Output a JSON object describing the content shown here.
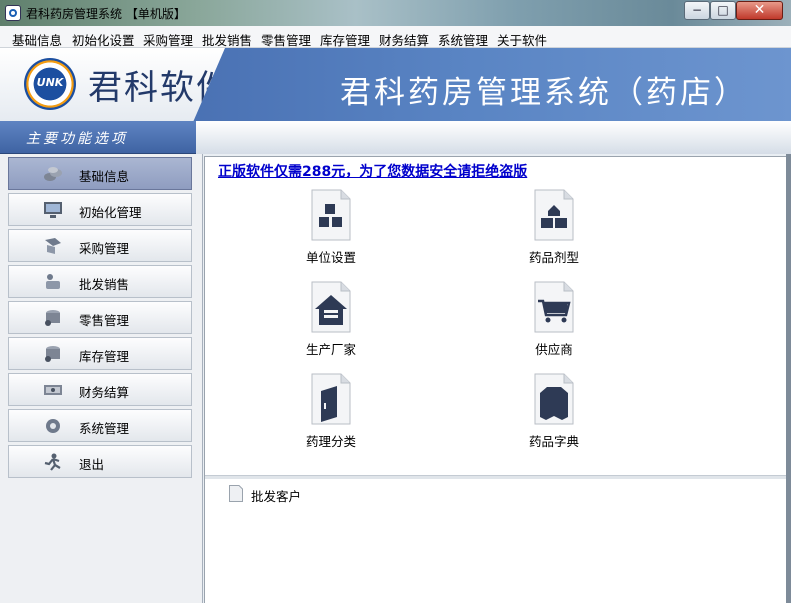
{
  "window": {
    "title": "君科药房管理系统 【单机版】",
    "buttons": {
      "minimize": "−",
      "maximize": "□",
      "close": "✕"
    }
  },
  "menu": [
    "基础信息",
    "初始化设置",
    "采购管理",
    "批发销售",
    "零售管理",
    "库存管理",
    "财务结算",
    "系统管理",
    "关于软件"
  ],
  "banner": {
    "logo_badge": "UNK",
    "logo_text": "君科软件",
    "system_title": "君科药房管理系统（药店）"
  },
  "sidebar": {
    "header": "主要功能选项",
    "items": [
      {
        "label": "基础信息",
        "icon": "stack-icon",
        "active": true
      },
      {
        "label": "初始化管理",
        "icon": "monitor-icon",
        "active": false
      },
      {
        "label": "采购管理",
        "icon": "purchase-icon",
        "active": false
      },
      {
        "label": "批发销售",
        "icon": "wholesale-icon",
        "active": false
      },
      {
        "label": "零售管理",
        "icon": "retail-icon",
        "active": false
      },
      {
        "label": "库存管理",
        "icon": "inventory-icon",
        "active": false
      },
      {
        "label": "财务结算",
        "icon": "money-icon",
        "active": false
      },
      {
        "label": "系统管理",
        "icon": "gear-icon",
        "active": false
      },
      {
        "label": "退出",
        "icon": "exit-icon",
        "active": false
      }
    ]
  },
  "main": {
    "promo": "正版软件仅需288元，为了您数据安全请拒绝盗版",
    "tiles": [
      {
        "label": "单位设置",
        "icon": "blocks-icon"
      },
      {
        "label": "药品剂型",
        "icon": "blocks-stack-icon"
      },
      {
        "label": "生产厂家",
        "icon": "house-icon"
      },
      {
        "label": "供应商",
        "icon": "cart-icon"
      },
      {
        "label": "药理分类",
        "icon": "book-icon"
      },
      {
        "label": "药品字典",
        "icon": "shirt-icon"
      }
    ],
    "sub_items": [
      {
        "label": "批发客户",
        "icon": "document-icon"
      }
    ]
  },
  "colors": {
    "banner_blue": "#4a72b4",
    "promo_link": "#0000cc",
    "icon_navy": "#2e3a55"
  }
}
